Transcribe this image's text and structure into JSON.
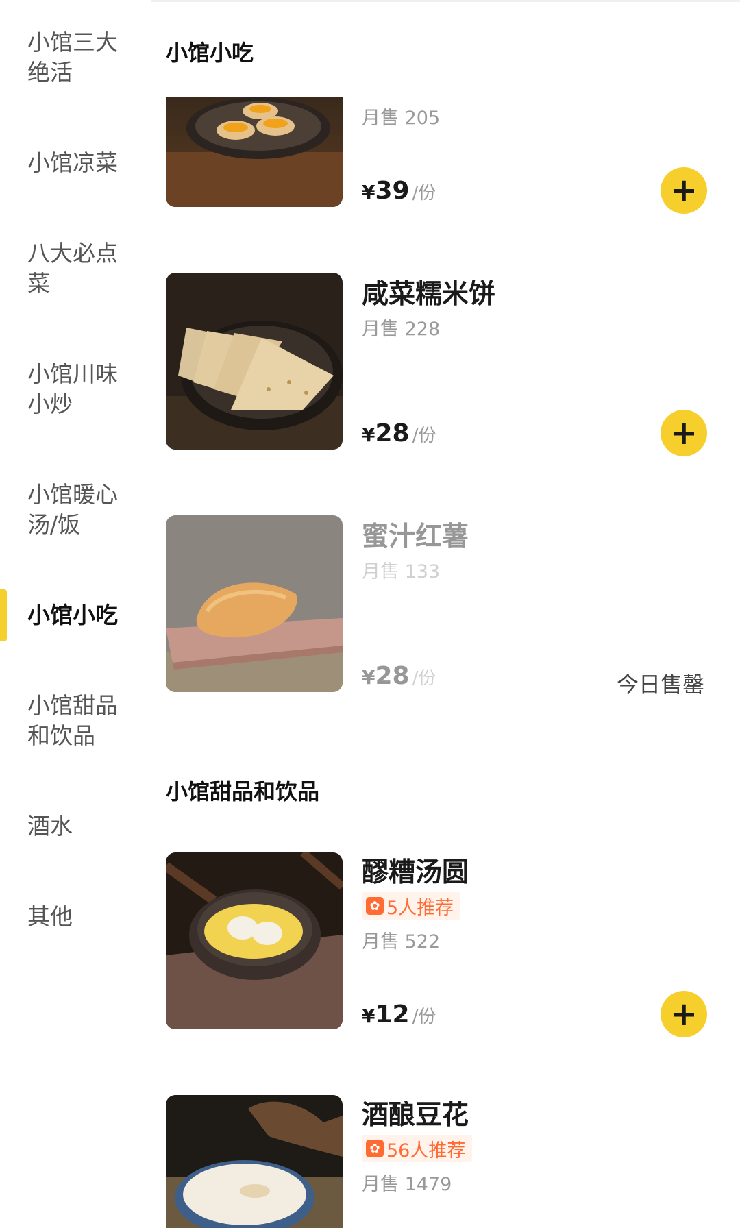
{
  "sidebar": {
    "items": [
      {
        "label": "小馆三大绝活"
      },
      {
        "label": "小馆凉菜"
      },
      {
        "label": "八大必点菜"
      },
      {
        "label": "小馆川味小炒"
      },
      {
        "label": "小馆暖心汤/饭"
      },
      {
        "label": "小馆小吃"
      },
      {
        "label": "小馆甜品和饮品"
      },
      {
        "label": "酒水"
      },
      {
        "label": "其他"
      }
    ]
  },
  "sections": [
    {
      "title": "小馆小吃"
    },
    {
      "title": "小馆甜品和饮品"
    }
  ],
  "items": [
    {
      "name": "",
      "sales": "月售 205",
      "price": "39",
      "currency": "¥",
      "unit": "/份"
    },
    {
      "name": "咸菜糯米饼",
      "sales": "月售 228",
      "price": "28",
      "currency": "¥",
      "unit": "/份"
    },
    {
      "name": "蜜汁红薯",
      "sales": "月售 133",
      "price": "28",
      "currency": "¥",
      "unit": "/份",
      "status": "今日售罄"
    },
    {
      "name": "醪糟汤圆",
      "badge": "5人推荐",
      "sales": "月售 522",
      "price": "12",
      "currency": "¥",
      "unit": "/份"
    },
    {
      "name": "酒酿豆花",
      "badge": "56人推荐",
      "sales": "月售 1479"
    }
  ],
  "add_label": "+",
  "colors": {
    "accent": "#f7cf2c",
    "badge": "#ff6b33"
  }
}
